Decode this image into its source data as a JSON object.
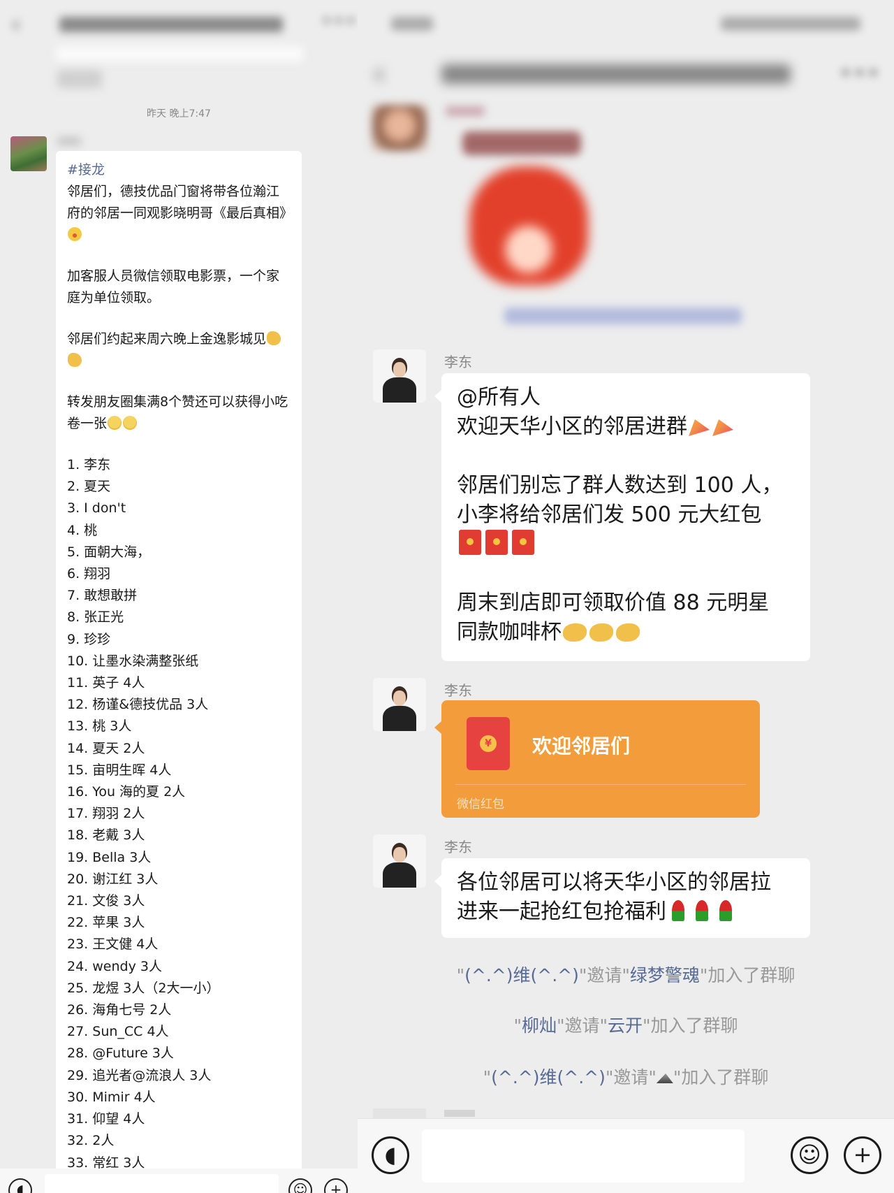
{
  "left": {
    "timestamp": "昨天 晚上7:47",
    "message": {
      "tag": "#接龙",
      "para1": "邻居们，德技优品门窗将带各位瀚江府的邻居一同观影晓明哥《最后真相》",
      "para2": "加客服人员微信领取电影票，一个家庭为单位领取。",
      "para3": "邻居们约起来周六晚上金逸影城见",
      "para4": "转发朋友圈集满8个赞还可以获得小吃卷一张",
      "list": [
        "1. 李东",
        "2. 夏天",
        "3. I don't",
        "4. 桃",
        "5. 面朝大海，",
        "6. 翔羽",
        "7. 敢想敢拼",
        "8. 张正光",
        "9. 珍珍",
        "10. 让墨水染满整张纸",
        "11. 英子 4人",
        "12. 杨谨&德技优品 3人",
        "13. 桃 3人",
        "14. 夏天 2人",
        "15. 亩明生晖 4人",
        "16. You 海的夏 2人",
        "17. 翔羽  2人",
        "18. 老戴 3人",
        "19. Bella 3人",
        "20. 谢江红 3人",
        "21. 文俊 3人",
        "22. 苹果 3人",
        "23. 王文健 4人",
        "24. wendy 3人",
        "25. 龙煜 3人（2大一小）",
        "26. 海角七号 2人",
        "27. Sun_CC 4人",
        "28. @Future 3人",
        "29. 追光者@流浪人 3人",
        "30. Mimir 4人",
        "31. 仰望 4人",
        "32. 2人",
        "33. 常红 3人"
      ]
    }
  },
  "right": {
    "messages": [
      {
        "sender": "李东",
        "lines": [
          "@所有人",
          "欢迎天华小区的邻居进群"
        ],
        "para2": [
          "邻居们别忘了群人数达到 100 人，",
          "小李将给邻居们发 500 元大红包"
        ],
        "para3": [
          "周末到店即可领取价值 88 元明星",
          "同款咖啡杯"
        ]
      },
      {
        "sender": "李东",
        "red_packet_title": "欢迎邻居们",
        "red_packet_footer": "微信红包"
      },
      {
        "sender": "李东",
        "lines": [
          "各位邻居可以将天华小区的邻居拉",
          "进来一起抢红包抢福利"
        ]
      }
    ],
    "system_messages": [
      {
        "q1": "\"",
        "a": "(^.^)维(^.^)",
        "mid": "\"邀请\"",
        "b": "绿梦警魂",
        "end": "\"加入了群聊"
      },
      {
        "q1": "\"",
        "a": "柳灿",
        "mid": "\"邀请\"",
        "b": "云开",
        "end": "\"加入了群聊"
      },
      {
        "q1": "\"",
        "a": "(^.^)维(^.^)",
        "mid": "\"邀请\"",
        "b": "",
        "end": "\"加入了群聊"
      }
    ]
  },
  "colors": {
    "chat_bg": "#ededed",
    "bubble": "#ffffff",
    "link": "#576b95",
    "red_packet": "#f39c3c"
  },
  "icons": [
    "back-arrow-icon",
    "more-icon",
    "voice-icon",
    "emoji-icon",
    "plus-icon",
    "red-packet-icon"
  ]
}
